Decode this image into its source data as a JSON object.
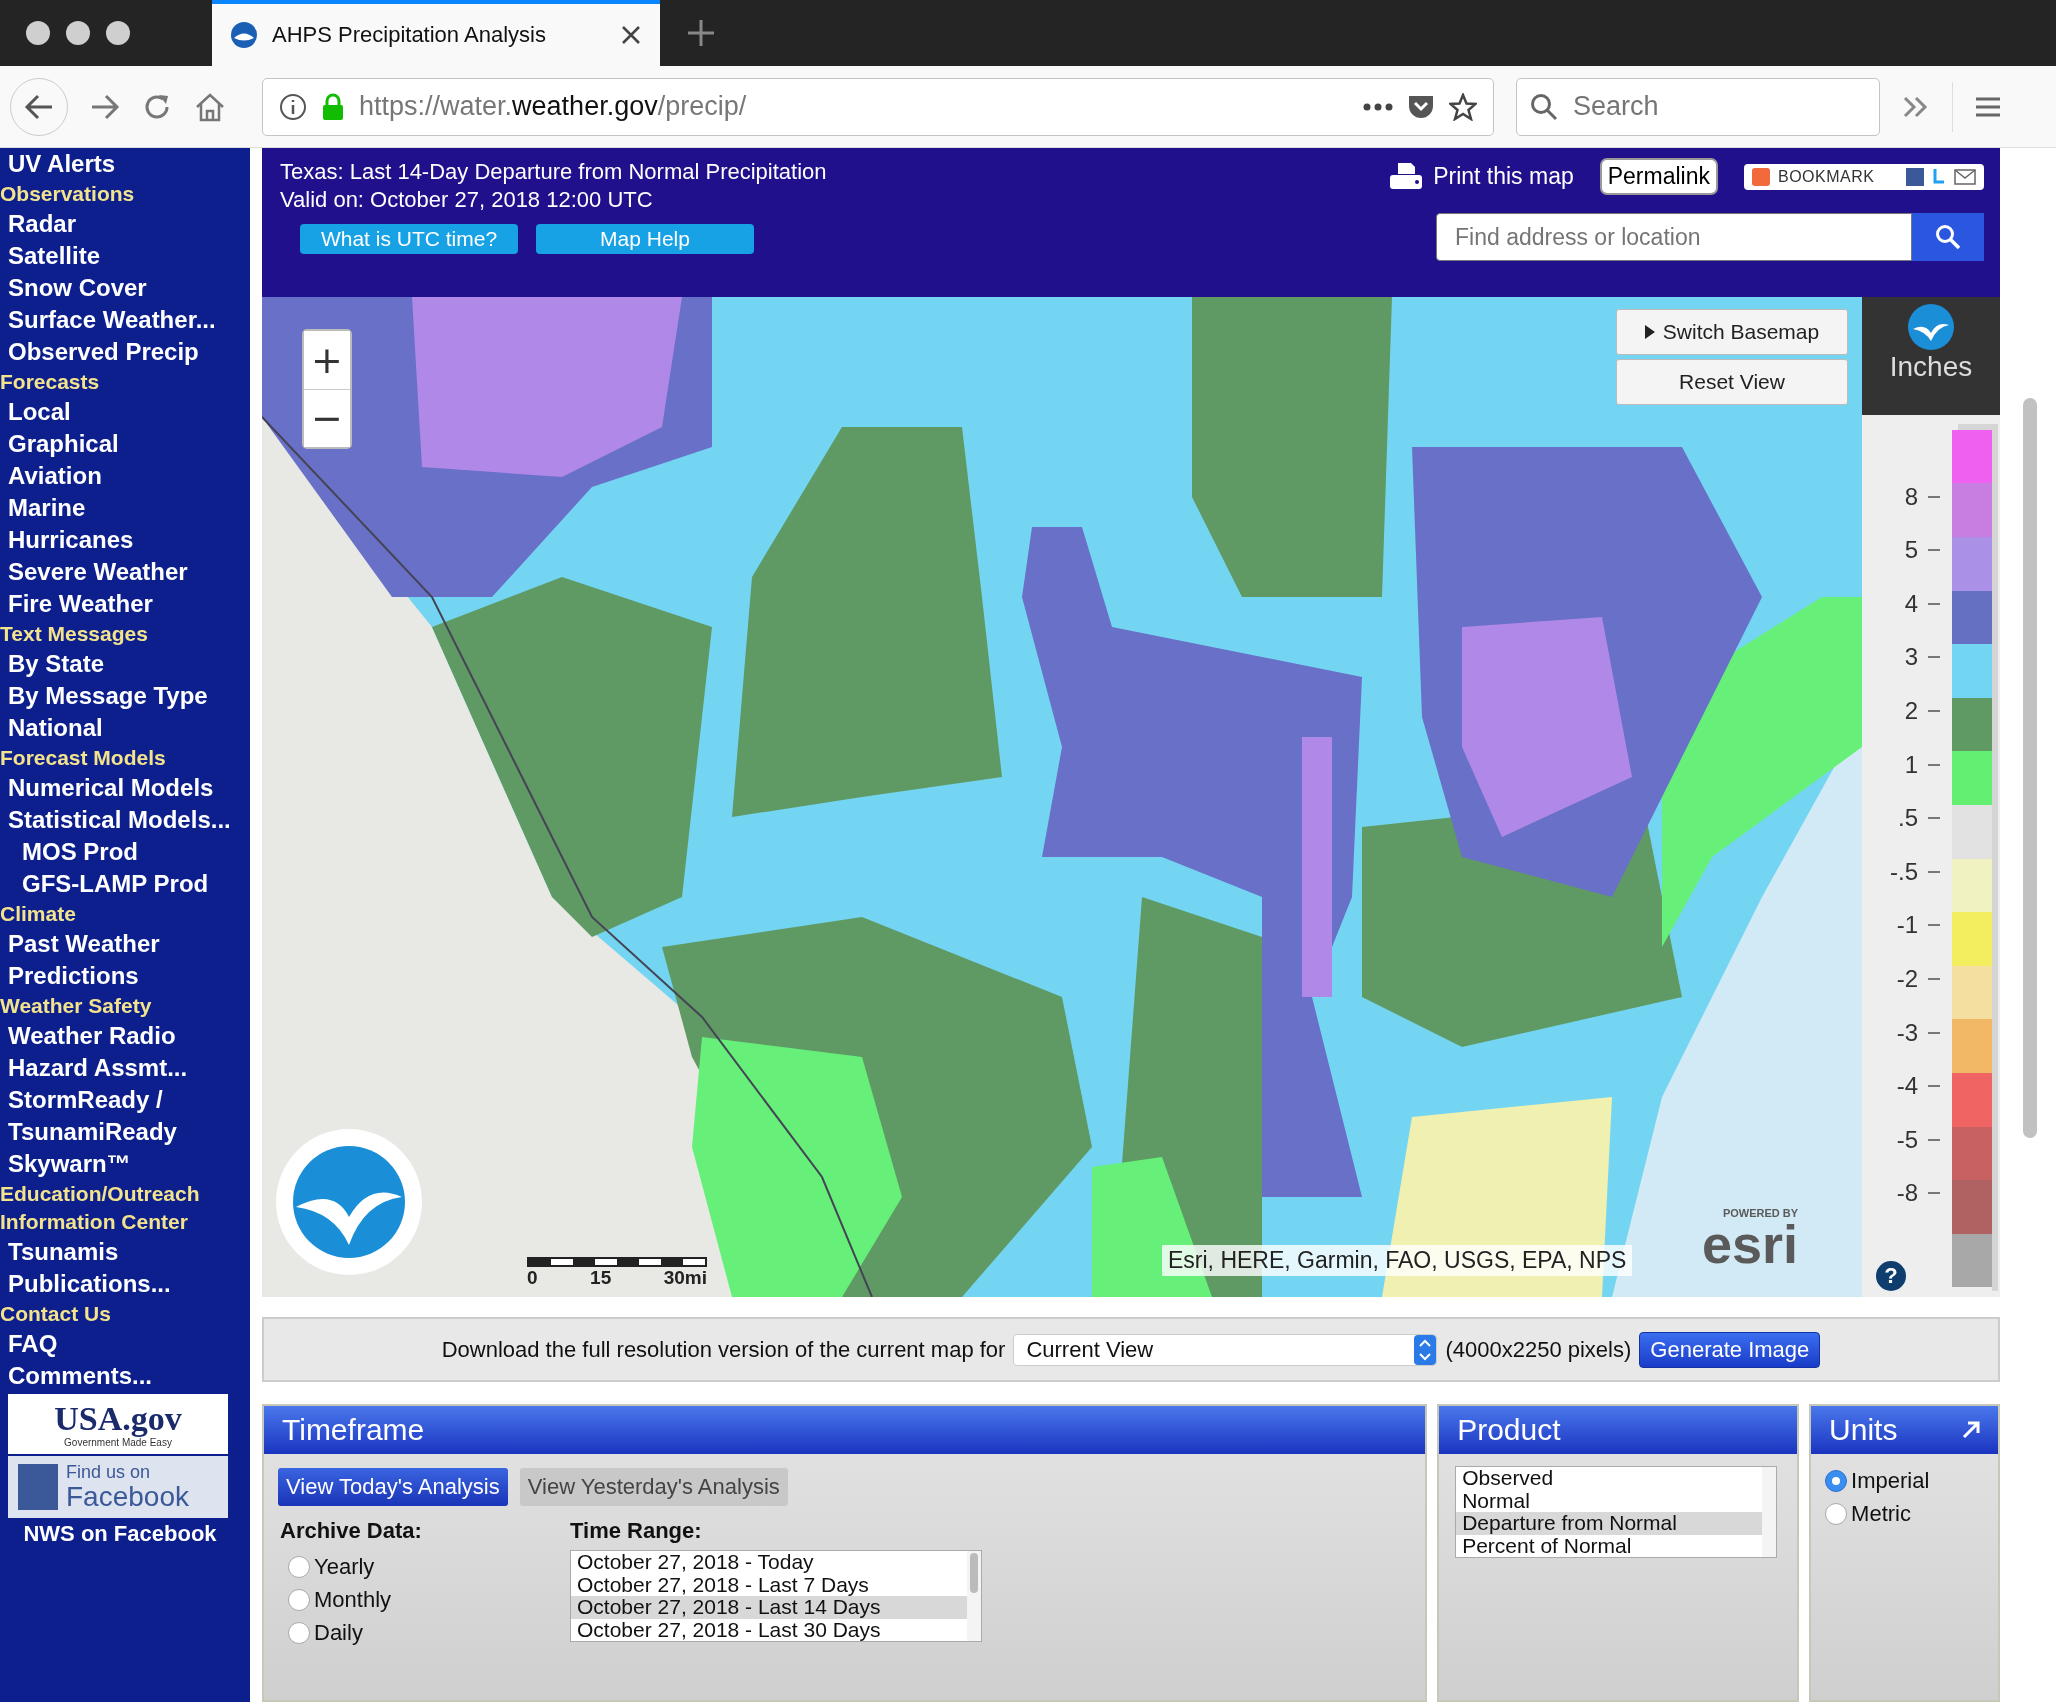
{
  "browser": {
    "tab": {
      "title": "AHPS Precipitation Analysis",
      "selected": true
    },
    "url": {
      "scheme": "https://water.",
      "domain": "weather.gov",
      "path": "/precip/"
    },
    "search": {
      "placeholder": "Search"
    }
  },
  "sidebar": {
    "items": [
      {
        "kind": "link",
        "text": "UV Alerts"
      },
      {
        "kind": "header",
        "text": "Observations"
      },
      {
        "kind": "link",
        "text": "Radar"
      },
      {
        "kind": "link",
        "text": "Satellite"
      },
      {
        "kind": "link",
        "text": "Snow Cover"
      },
      {
        "kind": "link",
        "text": "Surface Weather..."
      },
      {
        "kind": "link",
        "text": "Observed Precip"
      },
      {
        "kind": "header",
        "text": "Forecasts"
      },
      {
        "kind": "link",
        "text": "Local"
      },
      {
        "kind": "link",
        "text": "Graphical"
      },
      {
        "kind": "link",
        "text": "Aviation"
      },
      {
        "kind": "link",
        "text": "Marine"
      },
      {
        "kind": "link",
        "text": "Hurricanes"
      },
      {
        "kind": "link",
        "text": "Severe Weather"
      },
      {
        "kind": "link",
        "text": "Fire Weather"
      },
      {
        "kind": "header",
        "text": "Text Messages"
      },
      {
        "kind": "link",
        "text": "By State"
      },
      {
        "kind": "link",
        "text": "By Message Type"
      },
      {
        "kind": "link",
        "text": "National"
      },
      {
        "kind": "header",
        "text": "Forecast Models"
      },
      {
        "kind": "link",
        "text": "Numerical Models"
      },
      {
        "kind": "link",
        "text": "Statistical Models..."
      },
      {
        "kind": "sublink",
        "text": "MOS Prod"
      },
      {
        "kind": "sublink",
        "text": "GFS-LAMP Prod"
      },
      {
        "kind": "header",
        "text": "Climate"
      },
      {
        "kind": "link",
        "text": "Past Weather"
      },
      {
        "kind": "link",
        "text": "Predictions"
      },
      {
        "kind": "header",
        "text": "Weather Safety"
      },
      {
        "kind": "link",
        "text": "Weather Radio"
      },
      {
        "kind": "link",
        "text": "Hazard Assmt..."
      },
      {
        "kind": "link",
        "text": "StormReady /"
      },
      {
        "kind": "link",
        "text": "TsunamiReady"
      },
      {
        "kind": "link",
        "text": "Skywarn™"
      },
      {
        "kind": "header",
        "text": "Education/Outreach"
      },
      {
        "kind": "header",
        "text": "Information Center"
      },
      {
        "kind": "link",
        "text": "Tsunamis"
      },
      {
        "kind": "link",
        "text": "Publications..."
      },
      {
        "kind": "header",
        "text": "Contact Us"
      },
      {
        "kind": "link",
        "text": "FAQ"
      },
      {
        "kind": "link",
        "text": "Comments..."
      }
    ],
    "usagov": {
      "name": "USA.gov",
      "tagline": "Government Made Easy"
    },
    "facebook": {
      "top": "Find us on",
      "name": "Facebook"
    },
    "facebook_link": "NWS on Facebook"
  },
  "header": {
    "title": "Texas: Last 14-Day Departure from Normal Precipitation",
    "valid": "Valid on: October 27, 2018 12:00 UTC",
    "buttons": [
      "What is UTC time?",
      "Map Help"
    ],
    "print": "Print this map",
    "permalink": "Permalink",
    "bookmark": "BOOKMARK",
    "search": {
      "placeholder": "Find address or location"
    }
  },
  "map": {
    "zoom_in": "+",
    "zoom_out": "−",
    "basemap_button": "Switch Basemap",
    "reset_button": "Reset View",
    "scale": [
      "0",
      "15",
      "30mi"
    ],
    "attribution": "Esri, HERE, Garmin, FAO, USGS, EPA, NPS",
    "esri": {
      "powered": "POWERED BY",
      "name": "esri"
    },
    "legend": {
      "title": "Inches",
      "help": "?",
      "bins": [
        {
          "color": "#f060f0"
        },
        {
          "color": "#c77ee0"
        },
        {
          "color": "#aa90e6"
        },
        {
          "color": "#6670c2"
        },
        {
          "color": "#72d6f2"
        },
        {
          "color": "#5f9a64"
        },
        {
          "color": "#62ef72"
        },
        {
          "color": "#e2e2e2"
        },
        {
          "color": "#f0f2c2"
        },
        {
          "color": "#f2ee60"
        },
        {
          "color": "#f4dfa0"
        },
        {
          "color": "#f2b866"
        },
        {
          "color": "#f06464"
        },
        {
          "color": "#c86262"
        },
        {
          "color": "#b06262"
        },
        {
          "color": "#a8a8a8"
        }
      ],
      "labels": [
        "8",
        "5",
        "4",
        "3",
        "2",
        "1",
        ".5",
        "-.5",
        "-1",
        "-2",
        "-3",
        "-4",
        "-5",
        "-8"
      ]
    }
  },
  "download": {
    "text": "Download the full resolution version of the current map for",
    "select": "Current View",
    "size": "(4000x2250 pixels)",
    "button": "Generate Image"
  },
  "timeframe": {
    "title": "Timeframe",
    "tabs": [
      {
        "label": "View Today's Analysis",
        "selected": true
      },
      {
        "label": "View Yesterday's Analysis",
        "selected": false
      }
    ],
    "archive": {
      "label": "Archive Data:",
      "options": [
        {
          "label": "Yearly",
          "selected": false
        },
        {
          "label": "Monthly",
          "selected": false
        },
        {
          "label": "Daily",
          "selected": false
        }
      ]
    },
    "time_range": {
      "label": "Time Range:",
      "options": [
        {
          "label": "October 27, 2018 - Today",
          "selected": false
        },
        {
          "label": "October 27, 2018 - Last 7 Days",
          "selected": false
        },
        {
          "label": "October 27, 2018 - Last 14 Days",
          "selected": true
        },
        {
          "label": "October 27, 2018 - Last 30 Days",
          "selected": false
        }
      ]
    }
  },
  "product": {
    "title": "Product",
    "options": [
      {
        "label": "Observed",
        "selected": false
      },
      {
        "label": "Normal",
        "selected": false
      },
      {
        "label": "Departure from Normal",
        "selected": true
      },
      {
        "label": "Percent of Normal",
        "selected": false
      }
    ]
  },
  "units": {
    "title": "Units",
    "options": [
      {
        "label": "Imperial",
        "selected": true
      },
      {
        "label": "Metric",
        "selected": false
      }
    ]
  }
}
